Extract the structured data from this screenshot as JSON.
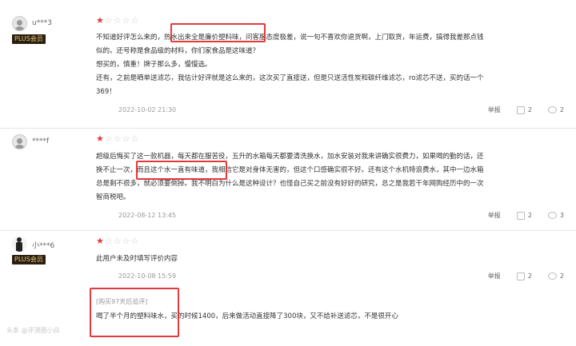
{
  "reviews": [
    {
      "username": "u***3",
      "badge": "PLUS会员",
      "rating": 1,
      "lines": [
        "不知道好评怎么来的，热水出来全是廉价塑料味，问客服态度极差，说一句不喜欢你退货啊，上门取货，年运费，搞得我差那点钱",
        "似的。还号称是食品级的材料，你们家食品是这味道？",
        "想买的，慎重！牌子那么多，慢慢选。",
        "还有，之前是晒单送滤芯，我估计好评就是这么来的，这次买了直接送，但是只送活性炭和碳纤维滤芯，ro滤芯不送，买的话一个",
        "369！"
      ],
      "date": "2022-10-02 21:30",
      "report": "举报",
      "likes": "2",
      "comments": "2"
    },
    {
      "username": "****f",
      "badge": "",
      "rating": 1,
      "lines": [
        "超级后悔买了这一款机器，每天都在服苦役，五升的水箱每天都要清洗换水，加水安装对我来讲确实很费力，如果喝的勤的话，还",
        "换不止一次，而且这个水一直有味道，我相信它是对身体无害的，但这个口感确实很不好。还有这个水机特浪费水，其中一边水箱",
        "总是剩不很多，就必须要倒掉。我不明白为什么是这种设计？也怪自己买之前没有好好的研究，总之是我若干年网购经历中的一次",
        "智商税吧。"
      ],
      "date": "2022-08-12 13:45",
      "report": "举报",
      "likes": "2",
      "comments": "3"
    },
    {
      "username": "小***6",
      "badge": "PLUS会员",
      "rating": 1,
      "lines": [
        "此用户未及时填写评价内容"
      ],
      "date": "2022-10-08 15:59",
      "report": "举报",
      "likes": "2",
      "comments": "2",
      "followup_tag": "[购买97天后追评]",
      "followup_text": "喝了半个月的塑料味水，买的时候1400，后来做活动直接降了300块，又不给补送滤芯，不是很开心"
    }
  ],
  "watermark": "头条 @评测圈小白"
}
